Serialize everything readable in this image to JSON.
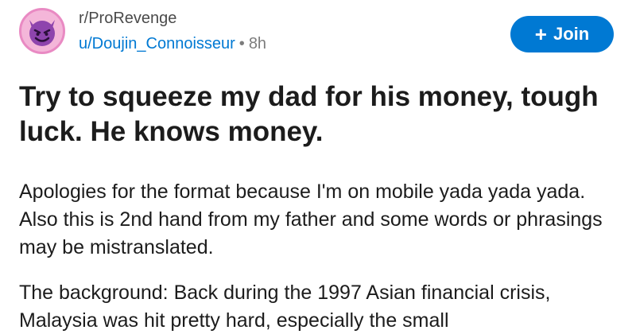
{
  "post": {
    "subreddit": "r/ProRevenge",
    "username": "u/Doujin_Connoisseur",
    "separator": "•",
    "time": "8h",
    "join_icon": "+",
    "join_label": "Join",
    "avatar_icon": "devil-face-icon",
    "title": "Try to squeeze my dad for his money, tough luck. He knows money.",
    "paragraphs": [
      "Apologies for the format because I'm on mobile yada yada yada. Also this is 2nd hand from my father and some words or phrasings may be mistranslated.",
      "The background: Back during the 1997 Asian financial crisis, Malaysia was hit pretty hard, especially the small"
    ]
  },
  "colors": {
    "accent": "#0079d3",
    "avatar_bg": "#f4b6d9",
    "avatar_face": "#8e44ad"
  }
}
